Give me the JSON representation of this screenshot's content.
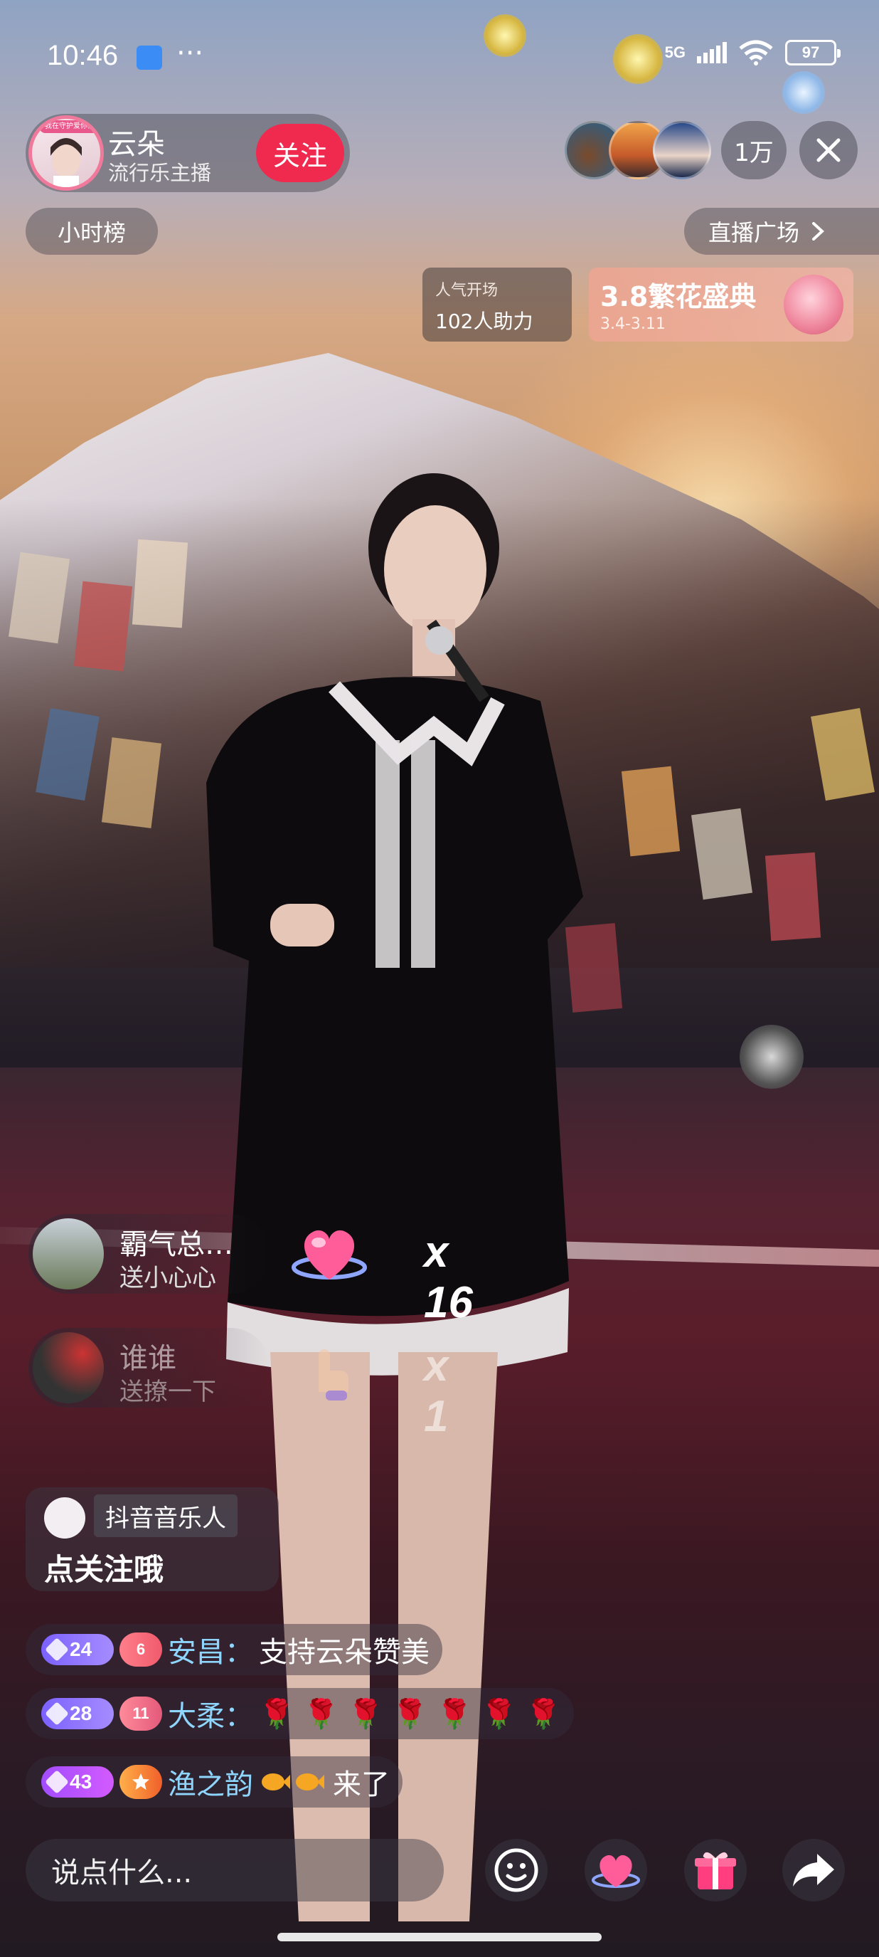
{
  "status_bar": {
    "time": "10:46",
    "network": "5G",
    "battery": "97"
  },
  "streamer": {
    "avatar_banner": "我在守护爱你们",
    "name": "云朵",
    "subtitle": "流行乐主播",
    "follow_label": "关注"
  },
  "viewers": {
    "count": "1万"
  },
  "nav": {
    "rank_label": "小时榜",
    "plaza_label": "直播广场"
  },
  "promo": {
    "left_line1": "人气开场",
    "left_line2": "102人助力",
    "right_title": "3.8繁花盛典",
    "right_dates": "3.4-3.11"
  },
  "gifts": [
    {
      "user": "霸气总…",
      "action": "送小心心",
      "count": "x 16"
    },
    {
      "user": "谁谁",
      "action": "送撩一下",
      "count": "x 1"
    }
  ],
  "music_card": {
    "tag": "抖音音乐人",
    "text": "点关注哦"
  },
  "chat": [
    {
      "level": "24",
      "fan_level": "6",
      "name": "安昌：",
      "message": "支持云朵赞美"
    },
    {
      "level": "28",
      "fan_level": "11",
      "name": "大柔：",
      "message": "🌹 🌹 🌹 🌹 🌹 🌹 🌹"
    },
    {
      "level": "43",
      "fan_level": "",
      "name": "渔之韵",
      "message": "来了"
    }
  ],
  "bottom_bar": {
    "input_placeholder": "说点什么..."
  },
  "colors": {
    "follow_red": "#f0294f",
    "chat_name_blue": "#8fd6ff",
    "level_purple": "#7b61ff"
  }
}
